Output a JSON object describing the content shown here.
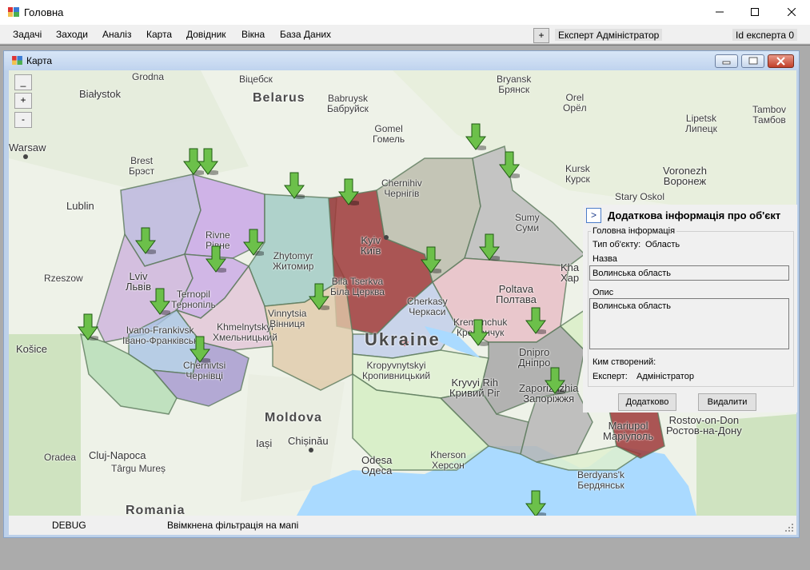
{
  "window": {
    "title": "Головна"
  },
  "menu": [
    "Задачі",
    "Заходи",
    "Аналіз",
    "Карта",
    "Довідник",
    "Вікна",
    "База Даних"
  ],
  "toolbar": {
    "plus_label": "+",
    "expert_label": "Експерт Адміністратор",
    "id_label": "Id експерта 0"
  },
  "child_window": {
    "title": "Карта"
  },
  "zoom": {
    "out": "_",
    "in": "+",
    "reset": "-"
  },
  "map": {
    "labels": {
      "belarus": "Belarus",
      "ukraine": "Ukraine",
      "moldova": "Moldova",
      "romania": "Romania",
      "warsaw": "Warsaw",
      "lublin": "Lublin",
      "bialystok": "Białystok",
      "brest": "Brest\nБрэст",
      "grodno": "Grodna",
      "vitebsk": "Віцебск",
      "babruysk": "Babruysk\nБабруйск",
      "gomel": "Gomel\nГомель",
      "bryansk": "Bryansk\nБрянск",
      "orel": "Orel\nОрёл",
      "lipetsk": "Lipetsk\nЛипецк",
      "tambov": "Tambov\nТамбов",
      "kursk": "Kursk\nКурск",
      "voronezh": "Voronezh\nВоронеж",
      "stary_oskol": "Stary Oskol",
      "sumy": "Sumy\nСуми",
      "chernihiv": "Chernihiv\nЧернігів",
      "kyiv": "Kyiv\nКиїв",
      "zhytomyr": "Zhytomyr\nЖитомир",
      "rivne": "Rivne\nРівне",
      "lviv": "Lviv\nЛьвів",
      "ternopil": "Ternopil\nТернопіль",
      "ivano": "Ivano-Frankivsk\nІвано-Франківськ",
      "khmelnytskyi": "Khmelnytskyi\nХмельницький",
      "chernivtsi": "Chernivtsi\nЧернівці",
      "vinnytsia": "Vinnytsia\nВінниця",
      "bila_tserkva": "Bila Tserkva\nБіла Церква",
      "cherkasy": "Cherkasy\nЧеркаси",
      "kremenchuk": "Kremenchuk\nКременчук",
      "poltava": "Poltava\nПолтава",
      "kropyvnytskyi": "Kropyvnytskyi\nКропивницький",
      "kryvyi_rih": "Kryvyi Rih\nКривий Ріг",
      "dnipro": "Dnipro\nДніпро",
      "zaporizhzhia": "Zaporizhzhia\nЗапоріжжя",
      "mariupol": "Mariupol\nМаріуполь",
      "rostov": "Rostov-on-Don\nРостов-на-Дону",
      "kherson": "Kherson\nХерсон",
      "odesa": "Odesa\nОдеса",
      "chisinau": "Chișinău",
      "iasi": "Iași",
      "cluj": "Cluj-Napoca",
      "targu_mures": "Târgu Mureș",
      "oradea": "Oradea",
      "kosice": "Košice",
      "rzeszow": "Rzeszow",
      "berdyansk": "Berdyans'k\nБердянськ",
      "kharkiv_partial": "Kha\nХар"
    }
  },
  "panel": {
    "expand_label": ">",
    "title": "Додаткова інформація про об'єкт",
    "group_legend": "Головна інформація",
    "type_label": "Тип об'єкту:",
    "type_value": "Область",
    "name_label": "Назва",
    "name_value": "Волинська область",
    "desc_label": "Опис",
    "desc_value": "Волинська область",
    "created_label": "Ким створений:",
    "expert_label": "Експерт:",
    "expert_value": "Адміністратор",
    "more_button": "Додатково",
    "delete_button": "Видалити"
  },
  "status": {
    "left": "DEBUG",
    "right": "Ввімкнена фільтрація на мапі"
  },
  "colors": {
    "marker": "#6cc04a",
    "kyiv_region": "#9e3a3a",
    "panel_bg": "#f0f0f0"
  }
}
